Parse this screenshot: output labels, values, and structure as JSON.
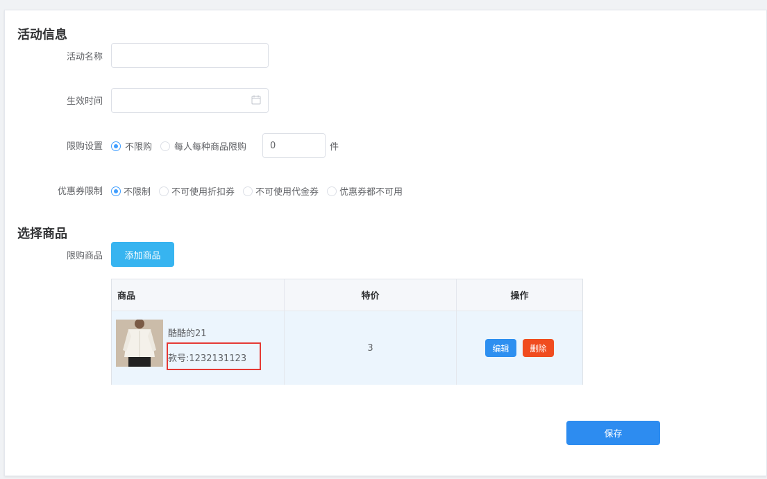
{
  "activity_section": {
    "title": "活动信息",
    "name_label": "活动名称",
    "name_value": "",
    "time_label": "生效时间",
    "time_value": "",
    "limit_label": "限购设置",
    "limit_options": [
      "不限购",
      "每人每种商品限购"
    ],
    "limit_selected": 0,
    "limit_qty": "0",
    "limit_unit": "件",
    "coupon_label": "优惠券限制",
    "coupon_options": [
      "不限制",
      "不可使用折扣券",
      "不可使用代金券",
      "优惠券都不可用"
    ],
    "coupon_selected": 0
  },
  "product_section": {
    "title": "选择商品",
    "label": "限购商品",
    "add_button": "添加商品",
    "table": {
      "headers": [
        "商品",
        "特价",
        "操作"
      ],
      "rows": [
        {
          "name": "酷酷的21",
          "sku": "款号:1232131123",
          "price": "3",
          "edit": "编辑",
          "delete": "删除"
        }
      ]
    }
  },
  "save_button": "保存",
  "colors": {
    "primary": "#409eff",
    "add_button": "#37b4f0",
    "edit_button": "#2d8ff0",
    "delete_button": "#f04c1f",
    "save_button": "#2d8cf0",
    "highlight": "#e53935"
  }
}
